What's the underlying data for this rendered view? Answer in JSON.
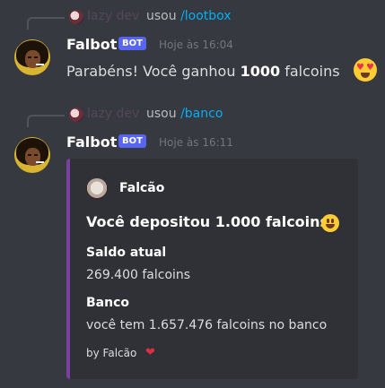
{
  "messages": [
    {
      "reply": {
        "username": "lazy dev",
        "action": "usou",
        "command": "/lootbox"
      },
      "author": "Falbot",
      "badge": "BOT",
      "timestamp": "Hoje às 16:04",
      "text": {
        "prefix": "Parabéns! Você ganhou ",
        "amount": "1000",
        "suffix": " falcoins"
      },
      "emoji": "heart-eyes-emoji"
    },
    {
      "reply": {
        "username": "lazy dev",
        "action": "usou",
        "command": "/banco"
      },
      "author": "Falbot",
      "badge": "BOT",
      "timestamp": "Hoje às 16:11",
      "embed": {
        "accent_color": "#7b3fa0",
        "author_name": "Falcão",
        "title": "Você depositou 1.000 falcoins",
        "title_emoji": "smiley-emoji",
        "fields": [
          {
            "name": "Saldo atual",
            "value": "269.400 falcoins"
          },
          {
            "name": "Banco",
            "value": "você tem 1.657.476 falcoins no banco"
          }
        ],
        "footer": "by Falcão",
        "footer_emoji": "heart-emoji"
      }
    }
  ]
}
